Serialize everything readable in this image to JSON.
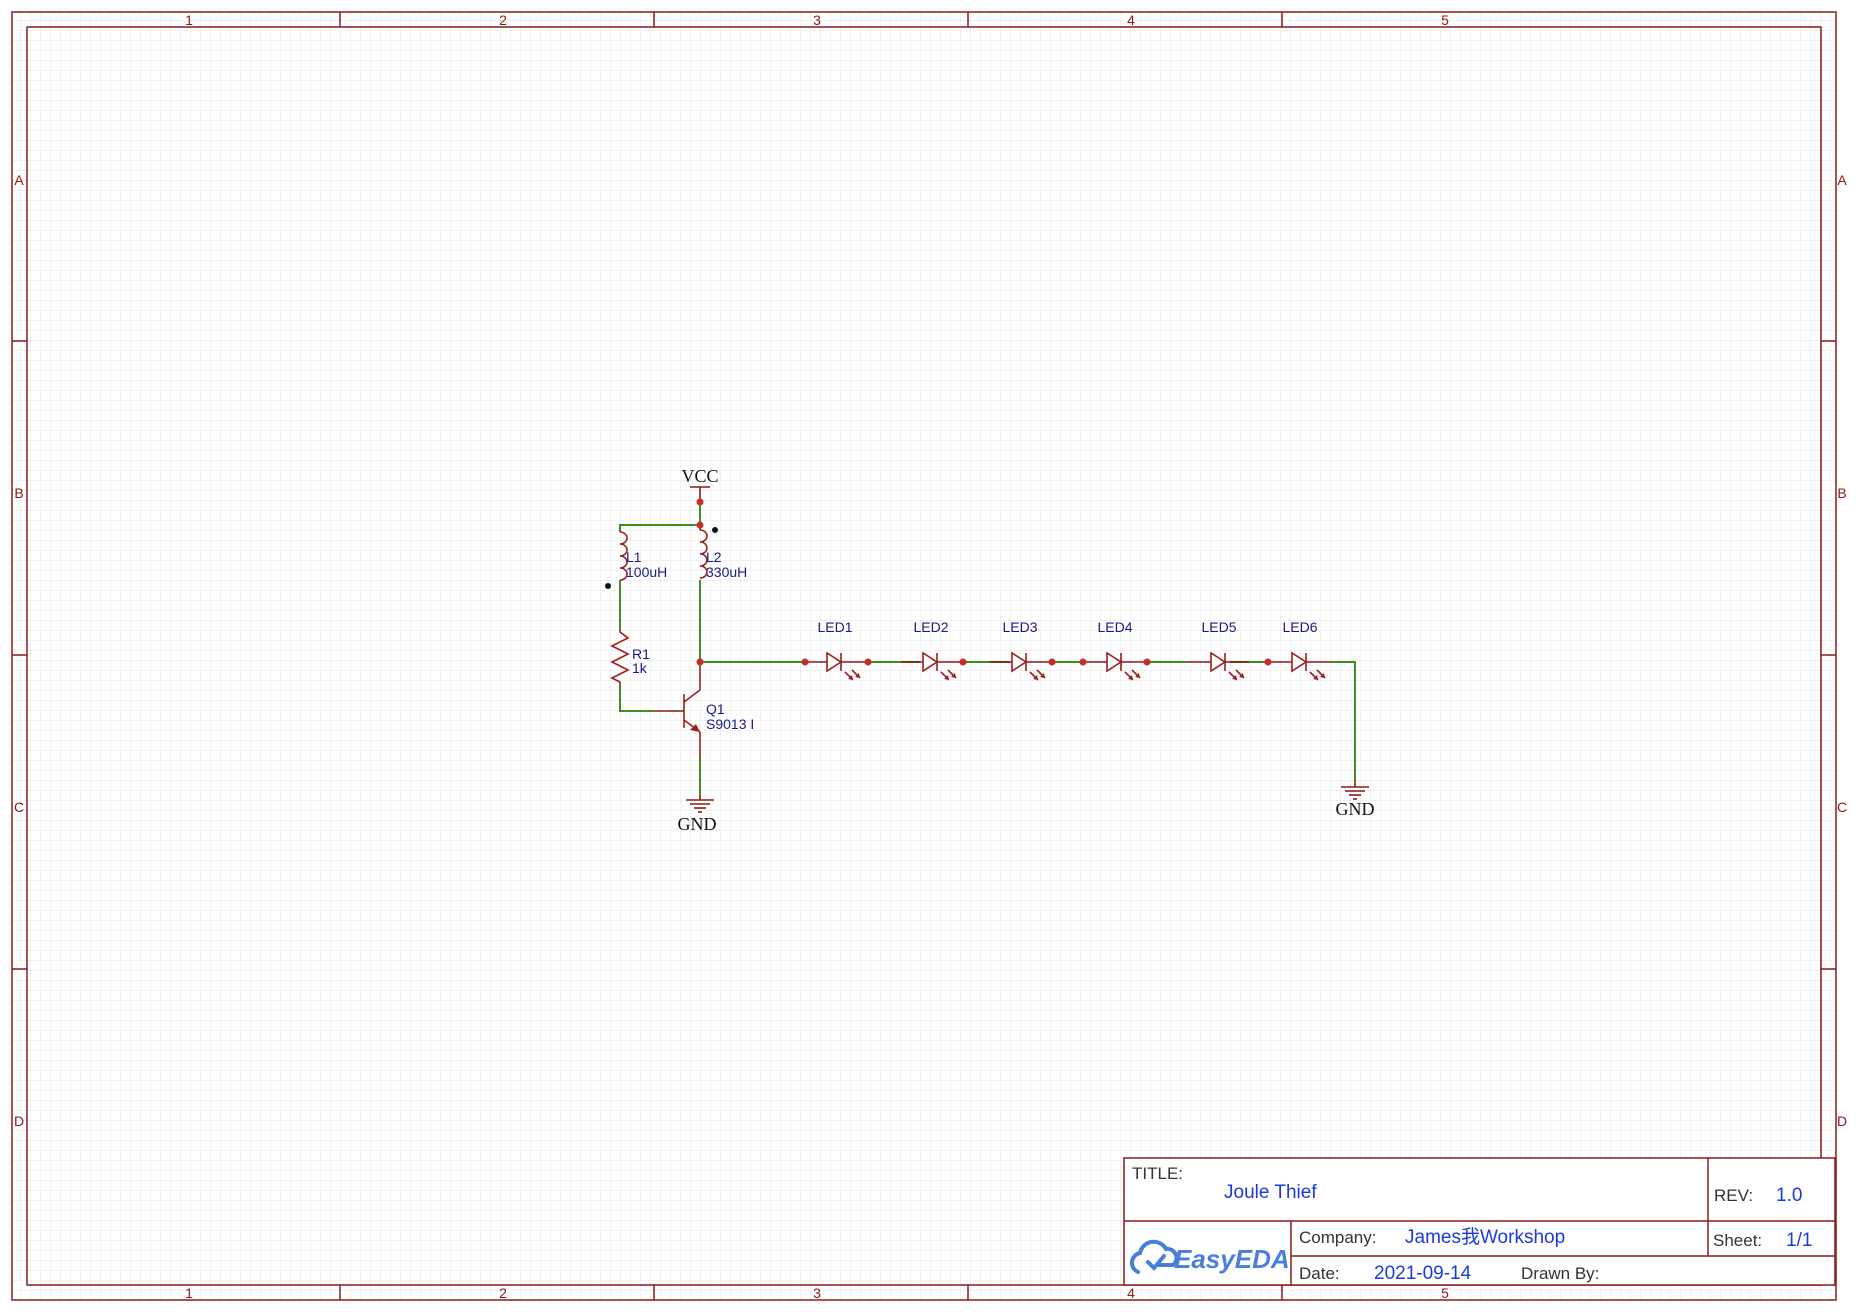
{
  "zones": {
    "columns": [
      "1",
      "2",
      "3",
      "4",
      "5"
    ],
    "rows": [
      "A",
      "B",
      "C",
      "D"
    ]
  },
  "power": {
    "vcc": "VCC",
    "gnd_left": "GND",
    "gnd_right": "GND"
  },
  "components": {
    "L1": {
      "ref": "L1",
      "value": "100uH"
    },
    "L2": {
      "ref": "L2",
      "value": "330uH"
    },
    "R1": {
      "ref": "R1",
      "value": "1k"
    },
    "Q1": {
      "ref": "Q1",
      "value": "S9013 I"
    },
    "leds": [
      "LED1",
      "LED2",
      "LED3",
      "LED4",
      "LED5",
      "LED6"
    ]
  },
  "title_block": {
    "title_label": "TITLE:",
    "title": "Joule Thief",
    "rev_label": "REV:",
    "rev": "1.0",
    "company_label": "Company:",
    "company": "James我Workshop",
    "sheet_label": "Sheet:",
    "sheet": "1/1",
    "date_label": "Date:",
    "date": "2021-09-14",
    "drawn_by_label": "Drawn By:",
    "logo_text": "EasyEDA"
  },
  "colors": {
    "frame": "#8b1a1a",
    "wire": "#3f8f1f",
    "component": "#9a1f1f",
    "label": "#1a1a8a",
    "title_value": "#1a3adf"
  }
}
